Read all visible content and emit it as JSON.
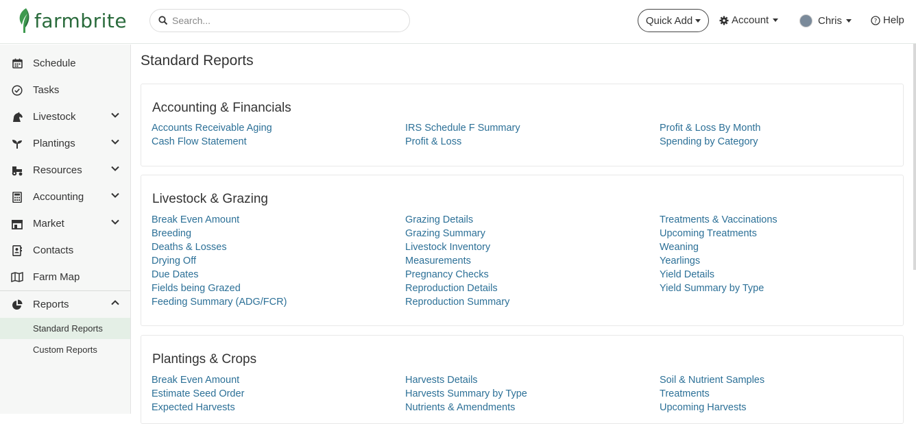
{
  "brand": {
    "name": "farmbrite",
    "color": "#2a6b3c"
  },
  "search": {
    "placeholder": "Search..."
  },
  "header": {
    "quick_add": "Quick Add",
    "account": "Account",
    "user": "Chris",
    "help": "Help"
  },
  "sidebar": {
    "items": [
      {
        "label": "Schedule",
        "icon": "calendar-icon"
      },
      {
        "label": "Tasks",
        "icon": "check-circle-icon"
      },
      {
        "label": "Livestock",
        "icon": "horse-icon",
        "expandable": true
      },
      {
        "label": "Plantings",
        "icon": "seedling-icon",
        "expandable": true
      },
      {
        "label": "Resources",
        "icon": "tractor-icon",
        "expandable": true
      },
      {
        "label": "Accounting",
        "icon": "calculator-icon",
        "expandable": true
      },
      {
        "label": "Market",
        "icon": "store-icon",
        "expandable": true
      },
      {
        "label": "Contacts",
        "icon": "address-book-icon"
      },
      {
        "label": "Farm Map",
        "icon": "map-icon"
      },
      {
        "label": "Reports",
        "icon": "pie-chart-icon",
        "expanded": true
      }
    ],
    "sub_items": [
      {
        "label": "Standard Reports",
        "active": true
      },
      {
        "label": "Custom Reports"
      }
    ]
  },
  "main": {
    "title": "Standard Reports",
    "sections": [
      {
        "title": "Accounting & Financials",
        "columns": [
          [
            "Accounts Receivable Aging",
            "Cash Flow Statement"
          ],
          [
            "IRS Schedule F Summary",
            "Profit & Loss"
          ],
          [
            "Profit & Loss By Month",
            "Spending by Category"
          ]
        ]
      },
      {
        "title": "Livestock & Grazing",
        "columns": [
          [
            "Break Even Amount",
            "Breeding",
            "Deaths & Losses",
            "Drying Off",
            "Due Dates",
            "Fields being Grazed",
            "Feeding Summary (ADG/FCR)"
          ],
          [
            "Grazing Details",
            "Grazing Summary",
            "Livestock Inventory",
            "Measurements",
            "Pregnancy Checks",
            "Reproduction Details",
            "Reproduction Summary"
          ],
          [
            "Treatments & Vaccinations",
            "Upcoming Treatments",
            "Weaning",
            "Yearlings",
            "Yield Details",
            "Yield Summary by Type"
          ]
        ]
      },
      {
        "title": "Plantings & Crops",
        "columns": [
          [
            "Break Even Amount",
            "Estimate Seed Order",
            "Expected Harvests"
          ],
          [
            "Harvests Details",
            "Harvests Summary by Type",
            "Nutrients & Amendments"
          ],
          [
            "Soil & Nutrient Samples",
            "Treatments",
            "Upcoming Harvests"
          ]
        ]
      }
    ]
  },
  "colors": {
    "link": "#2c7097",
    "active_bg": "#e4efe6",
    "sidebar_bg": "#f6f7f6"
  }
}
